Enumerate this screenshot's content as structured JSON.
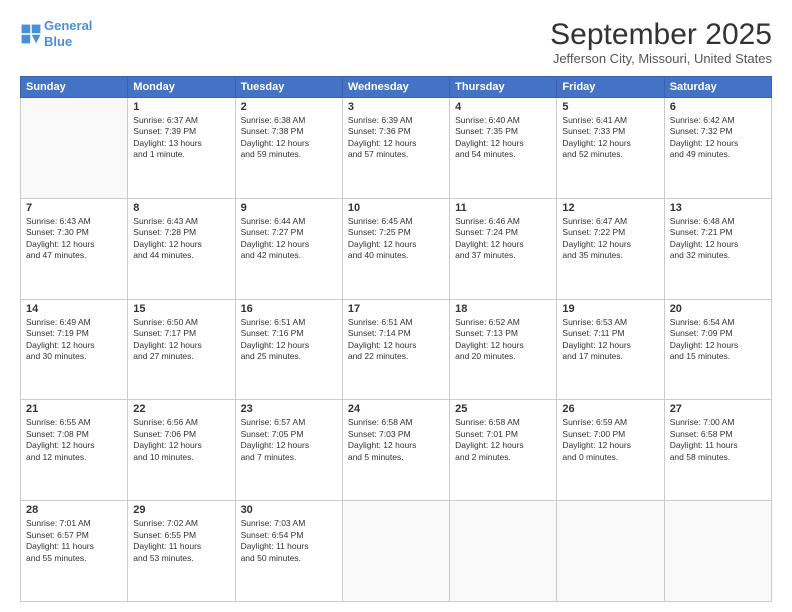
{
  "header": {
    "logo_line1": "General",
    "logo_line2": "Blue",
    "month": "September 2025",
    "location": "Jefferson City, Missouri, United States"
  },
  "days": [
    "Sunday",
    "Monday",
    "Tuesday",
    "Wednesday",
    "Thursday",
    "Friday",
    "Saturday"
  ],
  "weeks": [
    [
      {
        "day": "",
        "content": ""
      },
      {
        "day": "1",
        "content": "Sunrise: 6:37 AM\nSunset: 7:39 PM\nDaylight: 13 hours\nand 1 minute."
      },
      {
        "day": "2",
        "content": "Sunrise: 6:38 AM\nSunset: 7:38 PM\nDaylight: 12 hours\nand 59 minutes."
      },
      {
        "day": "3",
        "content": "Sunrise: 6:39 AM\nSunset: 7:36 PM\nDaylight: 12 hours\nand 57 minutes."
      },
      {
        "day": "4",
        "content": "Sunrise: 6:40 AM\nSunset: 7:35 PM\nDaylight: 12 hours\nand 54 minutes."
      },
      {
        "day": "5",
        "content": "Sunrise: 6:41 AM\nSunset: 7:33 PM\nDaylight: 12 hours\nand 52 minutes."
      },
      {
        "day": "6",
        "content": "Sunrise: 6:42 AM\nSunset: 7:32 PM\nDaylight: 12 hours\nand 49 minutes."
      }
    ],
    [
      {
        "day": "7",
        "content": "Sunrise: 6:43 AM\nSunset: 7:30 PM\nDaylight: 12 hours\nand 47 minutes."
      },
      {
        "day": "8",
        "content": "Sunrise: 6:43 AM\nSunset: 7:28 PM\nDaylight: 12 hours\nand 44 minutes."
      },
      {
        "day": "9",
        "content": "Sunrise: 6:44 AM\nSunset: 7:27 PM\nDaylight: 12 hours\nand 42 minutes."
      },
      {
        "day": "10",
        "content": "Sunrise: 6:45 AM\nSunset: 7:25 PM\nDaylight: 12 hours\nand 40 minutes."
      },
      {
        "day": "11",
        "content": "Sunrise: 6:46 AM\nSunset: 7:24 PM\nDaylight: 12 hours\nand 37 minutes."
      },
      {
        "day": "12",
        "content": "Sunrise: 6:47 AM\nSunset: 7:22 PM\nDaylight: 12 hours\nand 35 minutes."
      },
      {
        "day": "13",
        "content": "Sunrise: 6:48 AM\nSunset: 7:21 PM\nDaylight: 12 hours\nand 32 minutes."
      }
    ],
    [
      {
        "day": "14",
        "content": "Sunrise: 6:49 AM\nSunset: 7:19 PM\nDaylight: 12 hours\nand 30 minutes."
      },
      {
        "day": "15",
        "content": "Sunrise: 6:50 AM\nSunset: 7:17 PM\nDaylight: 12 hours\nand 27 minutes."
      },
      {
        "day": "16",
        "content": "Sunrise: 6:51 AM\nSunset: 7:16 PM\nDaylight: 12 hours\nand 25 minutes."
      },
      {
        "day": "17",
        "content": "Sunrise: 6:51 AM\nSunset: 7:14 PM\nDaylight: 12 hours\nand 22 minutes."
      },
      {
        "day": "18",
        "content": "Sunrise: 6:52 AM\nSunset: 7:13 PM\nDaylight: 12 hours\nand 20 minutes."
      },
      {
        "day": "19",
        "content": "Sunrise: 6:53 AM\nSunset: 7:11 PM\nDaylight: 12 hours\nand 17 minutes."
      },
      {
        "day": "20",
        "content": "Sunrise: 6:54 AM\nSunset: 7:09 PM\nDaylight: 12 hours\nand 15 minutes."
      }
    ],
    [
      {
        "day": "21",
        "content": "Sunrise: 6:55 AM\nSunset: 7:08 PM\nDaylight: 12 hours\nand 12 minutes."
      },
      {
        "day": "22",
        "content": "Sunrise: 6:56 AM\nSunset: 7:06 PM\nDaylight: 12 hours\nand 10 minutes."
      },
      {
        "day": "23",
        "content": "Sunrise: 6:57 AM\nSunset: 7:05 PM\nDaylight: 12 hours\nand 7 minutes."
      },
      {
        "day": "24",
        "content": "Sunrise: 6:58 AM\nSunset: 7:03 PM\nDaylight: 12 hours\nand 5 minutes."
      },
      {
        "day": "25",
        "content": "Sunrise: 6:58 AM\nSunset: 7:01 PM\nDaylight: 12 hours\nand 2 minutes."
      },
      {
        "day": "26",
        "content": "Sunrise: 6:59 AM\nSunset: 7:00 PM\nDaylight: 12 hours\nand 0 minutes."
      },
      {
        "day": "27",
        "content": "Sunrise: 7:00 AM\nSunset: 6:58 PM\nDaylight: 11 hours\nand 58 minutes."
      }
    ],
    [
      {
        "day": "28",
        "content": "Sunrise: 7:01 AM\nSunset: 6:57 PM\nDaylight: 11 hours\nand 55 minutes."
      },
      {
        "day": "29",
        "content": "Sunrise: 7:02 AM\nSunset: 6:55 PM\nDaylight: 11 hours\nand 53 minutes."
      },
      {
        "day": "30",
        "content": "Sunrise: 7:03 AM\nSunset: 6:54 PM\nDaylight: 11 hours\nand 50 minutes."
      },
      {
        "day": "",
        "content": ""
      },
      {
        "day": "",
        "content": ""
      },
      {
        "day": "",
        "content": ""
      },
      {
        "day": "",
        "content": ""
      }
    ]
  ]
}
